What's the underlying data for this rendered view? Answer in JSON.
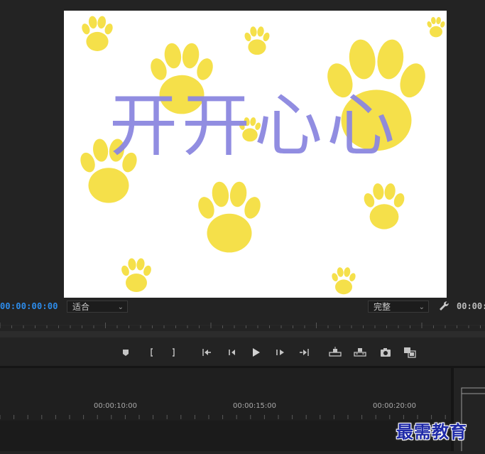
{
  "program_monitor": {
    "frame_text": "开开心心",
    "playhead_timecode": "00:00:00:00",
    "duration_timecode": "00:00:",
    "fit_select": "适合",
    "quality_select": "完整"
  },
  "transport": {
    "buttons": [
      "add-marker",
      "mark-in",
      "mark-out",
      "go-to-in",
      "step-back",
      "play",
      "step-forward",
      "go-to-out",
      "lift",
      "extract",
      "export-frame",
      "button-editor"
    ]
  },
  "timeline": {
    "ruler_labels": [
      "00:00:10:00",
      "00:00:15:00",
      "00:00:20:00"
    ]
  },
  "watermark": "最需教育",
  "colors": {
    "accent_timecode": "#2d8ceb",
    "paw_yellow": "#f5e04a",
    "text_purple": "#8c87e0",
    "background": "#232323"
  }
}
